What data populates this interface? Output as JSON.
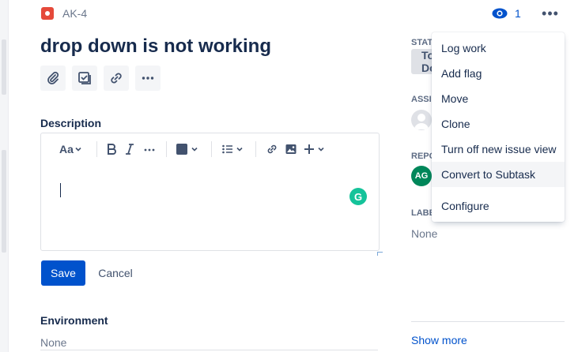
{
  "issue": {
    "key": "AK-4",
    "title": "drop down is not working",
    "watch_count": "1"
  },
  "description": {
    "label": "Description",
    "font_button": "Aa",
    "grammarly": "G"
  },
  "actions": {
    "save_label": "Save",
    "cancel_label": "Cancel"
  },
  "environment": {
    "label": "Environment",
    "value": "None"
  },
  "side": {
    "status_label": "STATUS",
    "status_value": "To Do",
    "assignee_label": "ASSIGNEE",
    "reporter_label": "REPORTER",
    "reporter_initials": "AG",
    "labels_label": "LABELS",
    "labels_value": "None",
    "show_more": "Show more"
  },
  "menu": {
    "items": [
      "Log work",
      "Add flag",
      "Move",
      "Clone",
      "Turn off new issue view",
      "Convert to Subtask",
      "Configure"
    ]
  },
  "icons": [
    "bug-icon",
    "eye-icon",
    "more-icon",
    "attachment-icon",
    "checklist-icon",
    "link-icon",
    "bold-icon",
    "italic-icon",
    "color-icon",
    "list-icon",
    "image-icon",
    "plus-icon",
    "chevron-down-icon"
  ],
  "colors": {
    "accent": "#0052cc",
    "bug": "#e5493a",
    "reporter": "#00875a",
    "grammarly": "#15c39a"
  }
}
